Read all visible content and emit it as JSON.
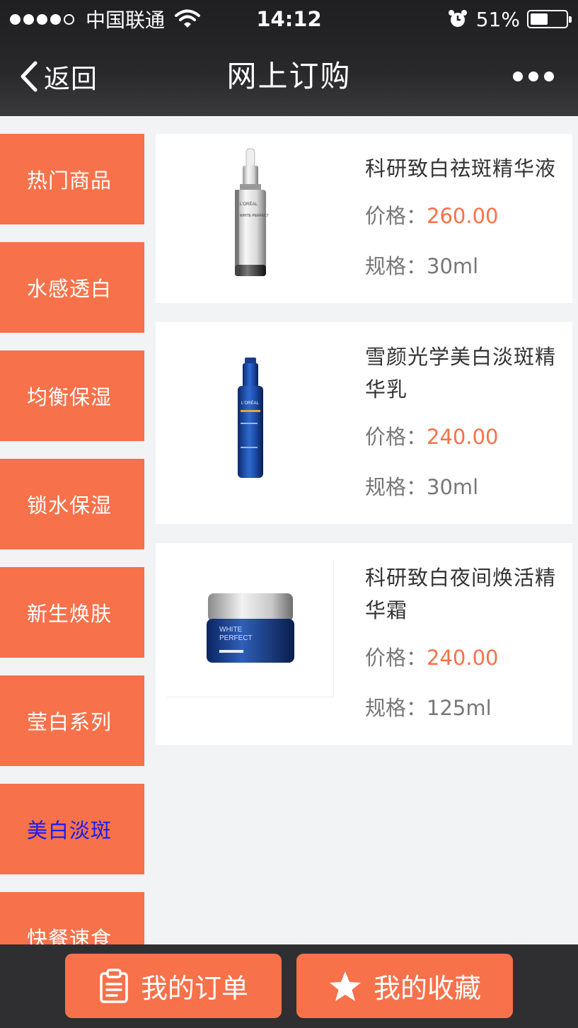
{
  "status_bar": {
    "carrier": "中国联通",
    "time": "14:12",
    "battery_percent": "51%",
    "battery_level": 0.51,
    "signal_bars": 4,
    "icons": [
      "signal-dots-icon",
      "wifi-icon",
      "alarm-clock-icon",
      "battery-icon"
    ]
  },
  "nav": {
    "back_label": "返回",
    "title": "网上订购",
    "icons": [
      "chevron-left-icon",
      "more-dots-icon"
    ]
  },
  "sidebar": {
    "active_index": 6,
    "items": [
      {
        "label": "热门商品"
      },
      {
        "label": "水感透白"
      },
      {
        "label": "均衡保湿"
      },
      {
        "label": "锁水保湿"
      },
      {
        "label": "新生焕肤"
      },
      {
        "label": "莹白系列"
      },
      {
        "label": "美白淡斑"
      },
      {
        "label": "快餐速食"
      }
    ]
  },
  "products": [
    {
      "name": "科研致白祛斑精华液",
      "price_label": "价格：",
      "price": "260.00",
      "spec_label": "规格：",
      "spec": "30ml",
      "image_icon": "serum-dropper-bottle-icon"
    },
    {
      "name": "雪颜光学美白淡斑精华乳",
      "price_label": "价格：",
      "price": "240.00",
      "spec_label": "规格：",
      "spec": "30ml",
      "image_icon": "pump-bottle-icon"
    },
    {
      "name": "科研致白夜间焕活精华霜",
      "price_label": "价格：",
      "price": "240.00",
      "spec_label": "规格：",
      "spec": "125ml",
      "image_icon": "cream-jar-icon"
    }
  ],
  "product_image_text": {
    "bottle1_brand": "L'ORÉAL",
    "bottle1_line": "WHITE PERFECT",
    "bottle2_brand": "L'ORÉAL",
    "jar_line1": "WHITE",
    "jar_line2": "PERFECT"
  },
  "bottom_bar": {
    "orders_label": "我的订单",
    "favorites_label": "我的收藏",
    "icons": [
      "clipboard-icon",
      "star-icon"
    ]
  },
  "colors": {
    "accent": "#f7714a",
    "active_category_text": "#1b1bf0",
    "header_bg": "#232325",
    "page_bg": "#f2f3f5"
  }
}
